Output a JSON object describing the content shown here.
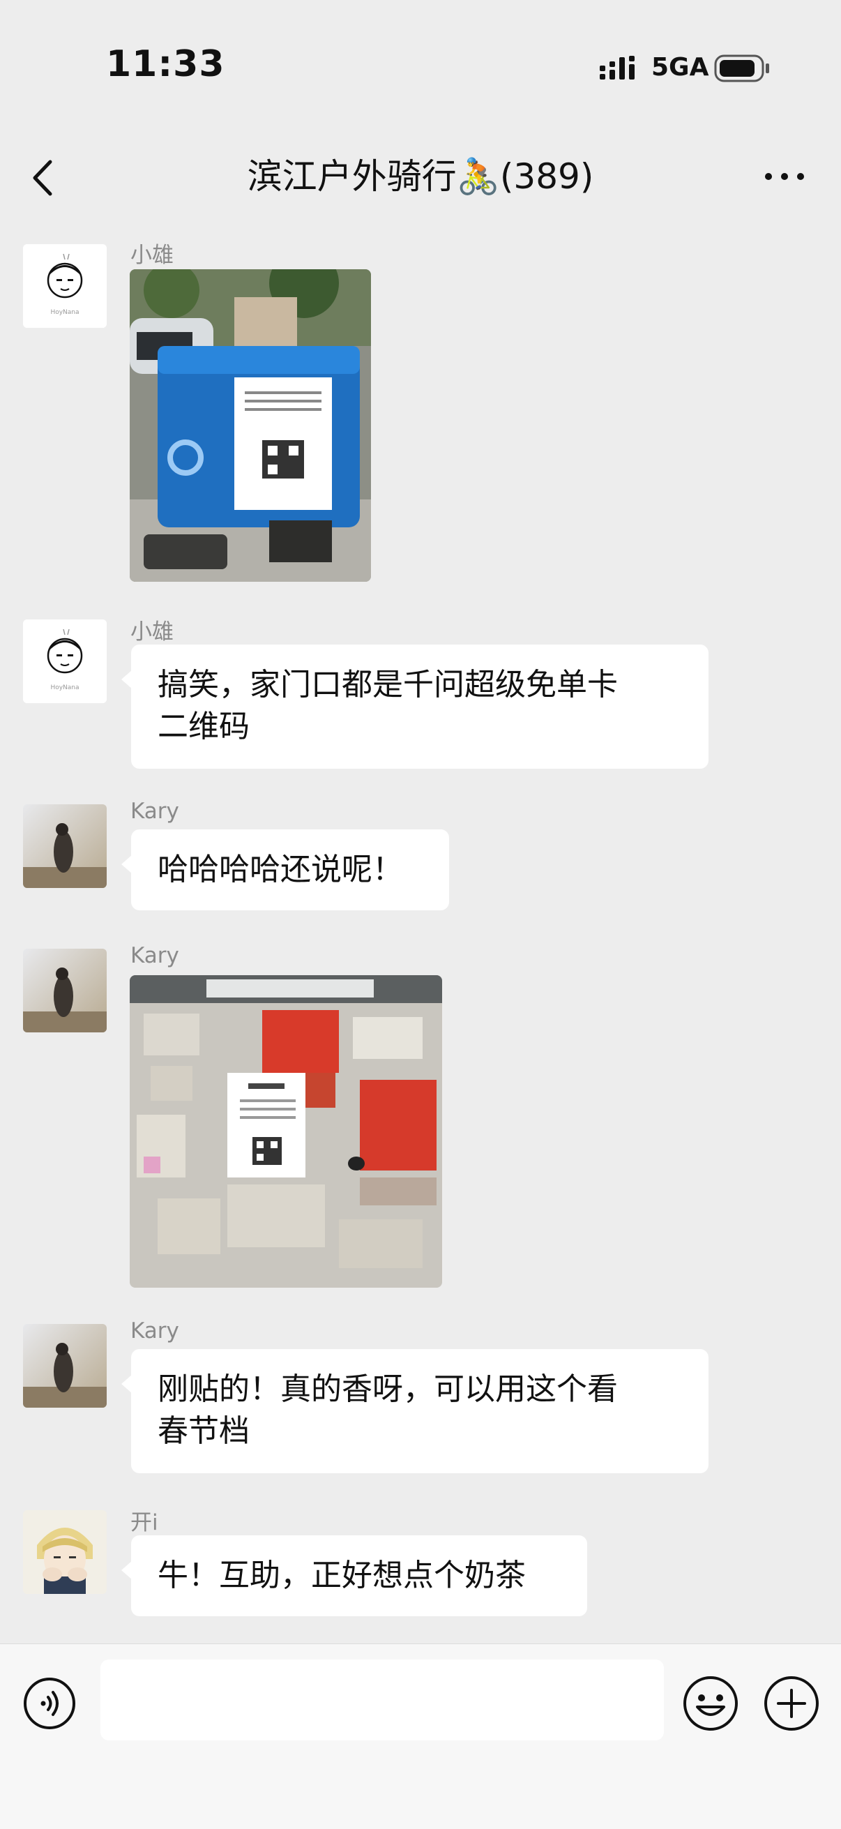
{
  "status_bar": {
    "time": "11:33",
    "network": "5GA",
    "icons": [
      "signal-icon",
      "battery-icon"
    ]
  },
  "nav": {
    "title": "滨江户外骑行🚴(389)",
    "icons": [
      "chevron-left-icon",
      "more-icon"
    ]
  },
  "messages": [
    {
      "sender": "小雄",
      "type": "image",
      "avatar": "line-drawing-face-avatar",
      "image": "photo-delivery-box-with-qr-poster"
    },
    {
      "sender": "小雄",
      "type": "text",
      "avatar": "line-drawing-face-avatar",
      "lines": [
        "搞笑，家门口都是千问超级免单卡",
        "二维码"
      ]
    },
    {
      "sender": "Kary",
      "type": "text",
      "avatar": "photo-avatar",
      "lines": [
        "哈哈哈哈还说呢！"
      ]
    },
    {
      "sender": "Kary",
      "type": "image",
      "avatar": "photo-avatar",
      "image": "photo-notice-board-with-qr-poster"
    },
    {
      "sender": "Kary",
      "type": "text",
      "avatar": "photo-avatar",
      "lines": [
        "刚贴的！真的香呀，可以用这个看",
        "春节档"
      ]
    },
    {
      "sender": "开i",
      "type": "text",
      "avatar": "anime-character-avatar",
      "lines": [
        "牛！互助，正好想点个奶茶"
      ]
    }
  ],
  "input_bar": {
    "placeholder": "",
    "icons": [
      "voice-icon",
      "emoji-icon",
      "plus-icon"
    ]
  },
  "colors": {
    "background": "#ededed",
    "bubble": "#ffffff",
    "sender_text": "#8a8a8a",
    "primary_text": "#111111"
  }
}
